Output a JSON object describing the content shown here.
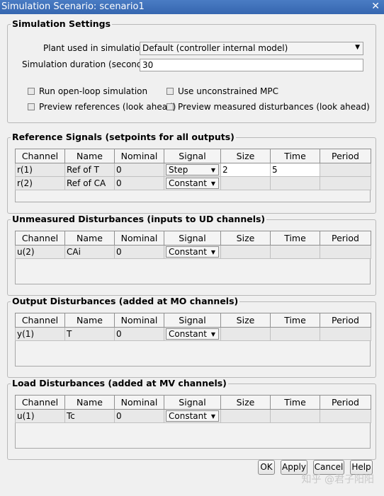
{
  "window": {
    "title": "Simulation Scenario: scenario1",
    "close_glyph": "✕"
  },
  "settings": {
    "group_title": "Simulation Settings",
    "plant_label": "Plant used in simulation:",
    "plant_value": "Default (controller internal model)",
    "duration_label": "Simulation duration (seconds)",
    "duration_value": "30",
    "checkboxes": {
      "open_loop": "Run open-loop simulation",
      "unconstrained": "Use unconstrained MPC",
      "preview_ref": "Preview references (look ahead)",
      "preview_md": "Preview measured disturbances (look ahead)"
    }
  },
  "columns": [
    "Channel",
    "Name",
    "Nominal",
    "Signal",
    "Size",
    "Time",
    "Period"
  ],
  "reference": {
    "group_title": "Reference Signals (setpoints for all outputs)",
    "rows": [
      {
        "channel": "r(1)",
        "name": "Ref of T",
        "nominal": "0",
        "signal": "Step",
        "size": "2",
        "time": "5",
        "period": ""
      },
      {
        "channel": "r(2)",
        "name": "Ref of CA",
        "nominal": "0",
        "signal": "Constant",
        "size": "",
        "time": "",
        "period": ""
      }
    ]
  },
  "unmeasured": {
    "group_title": "Unmeasured Disturbances (inputs to UD channels)",
    "rows": [
      {
        "channel": "u(2)",
        "name": "CAi",
        "nominal": "0",
        "signal": "Constant",
        "size": "",
        "time": "",
        "period": ""
      }
    ]
  },
  "output": {
    "group_title": "Output Disturbances (added at MO channels)",
    "rows": [
      {
        "channel": "y(1)",
        "name": "T",
        "nominal": "0",
        "signal": "Constant",
        "size": "",
        "time": "",
        "period": ""
      }
    ]
  },
  "load": {
    "group_title": "Load Disturbances (added at MV channels)",
    "rows": [
      {
        "channel": "u(1)",
        "name": "Tc",
        "nominal": "0",
        "signal": "Constant",
        "size": "",
        "time": "",
        "period": ""
      }
    ]
  },
  "buttons": {
    "ok": "OK",
    "apply": "Apply",
    "cancel": "Cancel",
    "help": "Help"
  },
  "watermark": "知乎 @君子阳阳"
}
